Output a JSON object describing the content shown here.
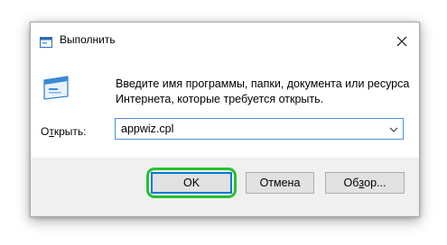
{
  "window": {
    "title": "Выполнить",
    "icon": "run-icon",
    "close_icon": "close-icon"
  },
  "content": {
    "icon": "run-program-icon",
    "description_line1": "Введите имя программы, папки, документа или ресурса",
    "description_line2": "Интернета, которые требуется открыть.",
    "open_label_prefix": "О",
    "open_label_accel": "т",
    "open_label_suffix": "крыть:",
    "input_value": "appwiz.cpl"
  },
  "buttons": {
    "ok": "OK",
    "cancel": "Отмена",
    "browse_prefix": "Об",
    "browse_accel": "з",
    "browse_suffix": "ор..."
  },
  "colors": {
    "focus_border": "#0078d7",
    "highlight": "#28c030",
    "footer_bg": "#f0f0f0"
  }
}
